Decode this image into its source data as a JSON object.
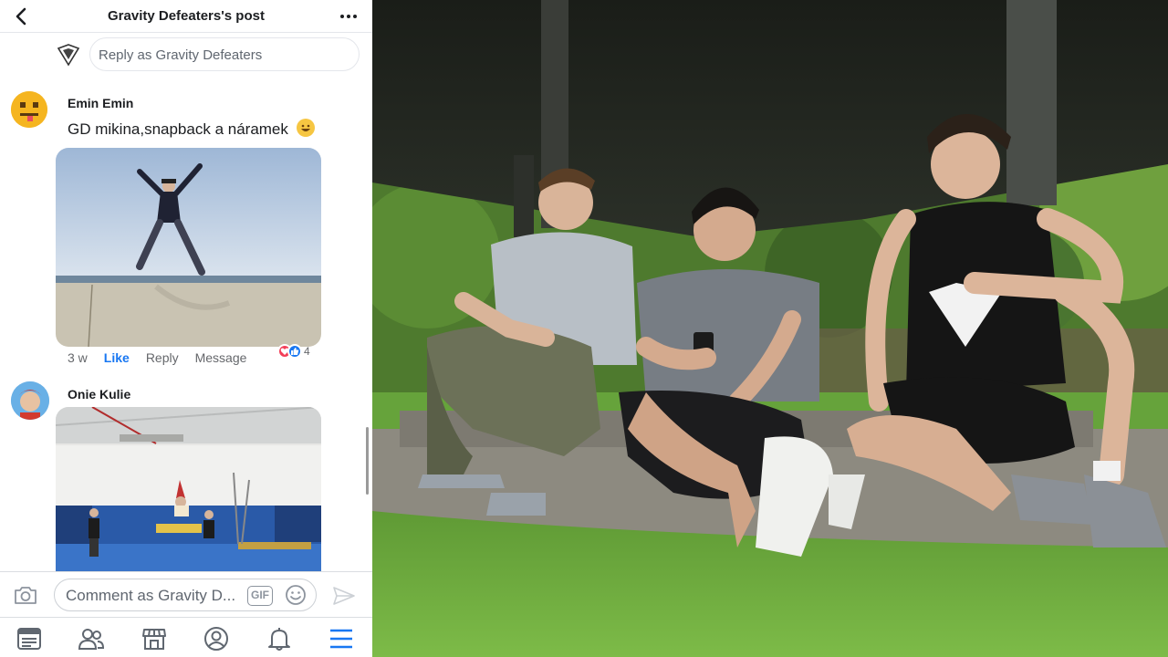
{
  "header": {
    "title": "Gravity Defeaters's post"
  },
  "reply": {
    "placeholder": "Reply as Gravity Defeaters"
  },
  "comments": [
    {
      "author": "Emin Emin",
      "text": "GD mikina,snapback a náramek",
      "time": "3 w",
      "like_label": "Like",
      "reply_label": "Reply",
      "message_label": "Message",
      "reaction_count": "4",
      "reactions": [
        "love",
        "like"
      ]
    },
    {
      "author": "Onie Kulie"
    }
  ],
  "composer": {
    "placeholder": "Comment as Gravity D...",
    "gif_label": "GIF"
  },
  "tabs": [
    "news-feed",
    "friends",
    "marketplace",
    "profile",
    "notifications",
    "menu"
  ],
  "colors": {
    "accent": "#1877f2",
    "love": "#f33e58",
    "text": "#1c1e21",
    "muted": "#65676b"
  }
}
